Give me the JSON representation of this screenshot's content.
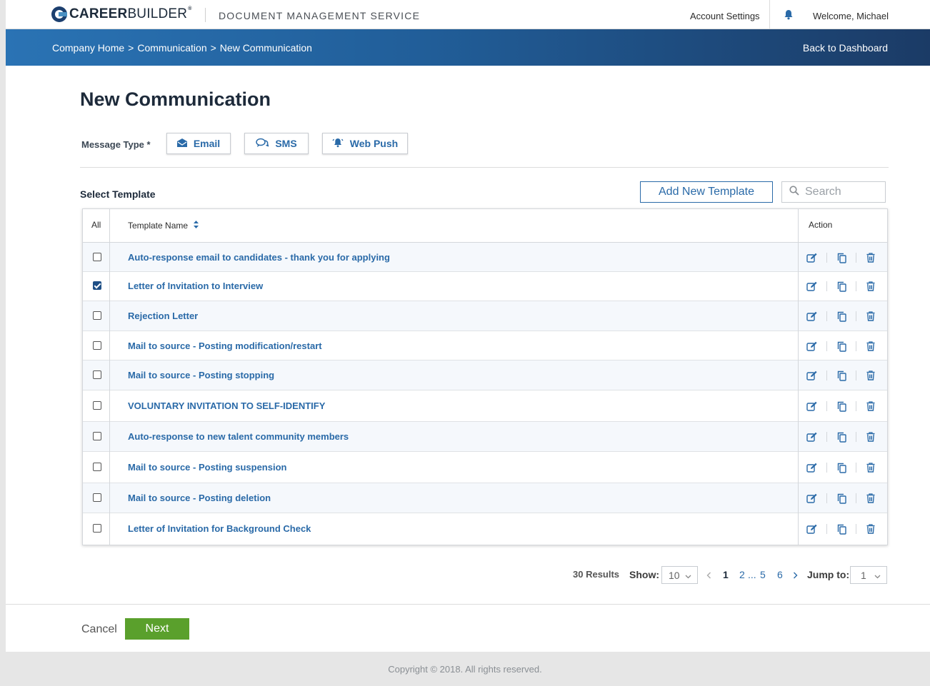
{
  "header": {
    "logo_bold": "CAREER",
    "logo_light": "BUILDER",
    "logo_reg": "®",
    "app_name": "DOCUMENT MANAGEMENT SERVICE",
    "account_settings": "Account Settings",
    "welcome": "Welcome, Michael"
  },
  "banner": {
    "breadcrumbs": [
      "Company Home",
      "Communication",
      "New Communication"
    ],
    "separator": ">",
    "back_link": "Back to Dashboard"
  },
  "page": {
    "title": "New Communication",
    "message_type_label": "Message Type *",
    "message_types": [
      {
        "label": "Email",
        "icon": "envelope-icon"
      },
      {
        "label": "SMS",
        "icon": "chat-bubbles-icon"
      },
      {
        "label": "Web Push",
        "icon": "bell-icon"
      }
    ],
    "select_template_label": "Select Template",
    "add_template_button": "Add New Template",
    "search_placeholder": "Search"
  },
  "table": {
    "headers": {
      "all": "All",
      "name": "Template Name",
      "action": "Action"
    },
    "rows": [
      {
        "name": "Auto-response email to candidates - thank you for applying",
        "checked": false
      },
      {
        "name": "Letter of Invitation to Interview",
        "checked": true
      },
      {
        "name": "Rejection Letter",
        "checked": false
      },
      {
        "name": "Mail to source - Posting modification/restart",
        "checked": false
      },
      {
        "name": "Mail to source - Posting stopping",
        "checked": false
      },
      {
        "name": "VOLUNTARY INVITATION TO SELF-IDENTIFY",
        "checked": false
      },
      {
        "name": "Auto-response to new talent community members",
        "checked": false
      },
      {
        "name": "Mail to source - Posting suspension",
        "checked": false
      },
      {
        "name": "Mail to source - Posting deletion",
        "checked": false
      },
      {
        "name": "Letter of Invitation for Background Check",
        "checked": false
      }
    ]
  },
  "pagination": {
    "results": "30 Results",
    "show_label": "Show:",
    "show_value": "10",
    "pages": [
      "1",
      "2",
      "...",
      "5",
      "6"
    ],
    "current_page": "1",
    "jump_label": "Jump to:",
    "jump_value": "1"
  },
  "footer_actions": {
    "cancel": "Cancel",
    "next": "Next"
  },
  "footer": {
    "copyright": "Copyright © 2018. All rights reserved."
  },
  "colors": {
    "accent": "#2a6aa8",
    "banner_start": "#2a73b4",
    "banner_end": "#1b3b66",
    "next_button": "#5aa02c"
  }
}
